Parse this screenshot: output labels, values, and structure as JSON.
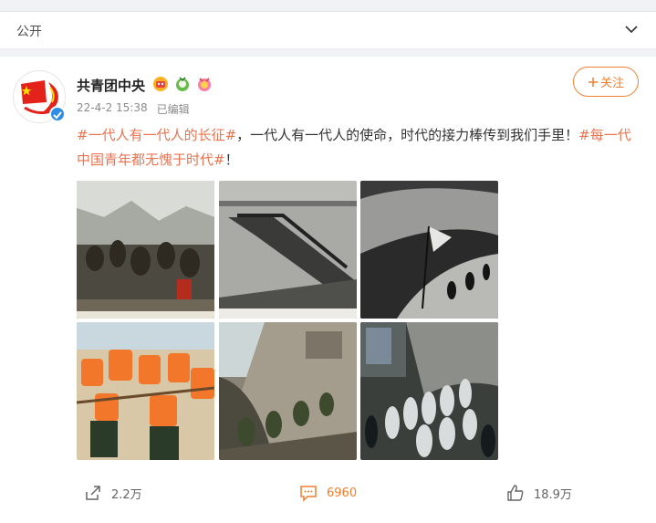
{
  "header": {
    "title": "公开"
  },
  "post": {
    "author": "共青团中央",
    "time": "22-4-2 15:38",
    "edited": "已编辑",
    "follow_label": "关注",
    "content": {
      "tag1": "#一代人有一代人的长征#",
      "text": "，一代人有一代人的使命，时代的接力棒传到我们手里！",
      "tag2": "#每一代中国青年都无愧于时代#",
      "end": "！"
    },
    "images": [
      {
        "name": "long-march-painting"
      },
      {
        "name": "river-crossing-photo"
      },
      {
        "name": "mountain-march-photo"
      },
      {
        "name": "flood-rescue-photo"
      },
      {
        "name": "landslide-rescue-photo"
      },
      {
        "name": "medical-workers-photo"
      }
    ]
  },
  "actions": {
    "share": "2.2万",
    "comment": "6960",
    "like": "18.9万"
  },
  "colors": {
    "accent": "#f37e2d",
    "tag": "#eb7350",
    "verified": "#2e8de6"
  }
}
